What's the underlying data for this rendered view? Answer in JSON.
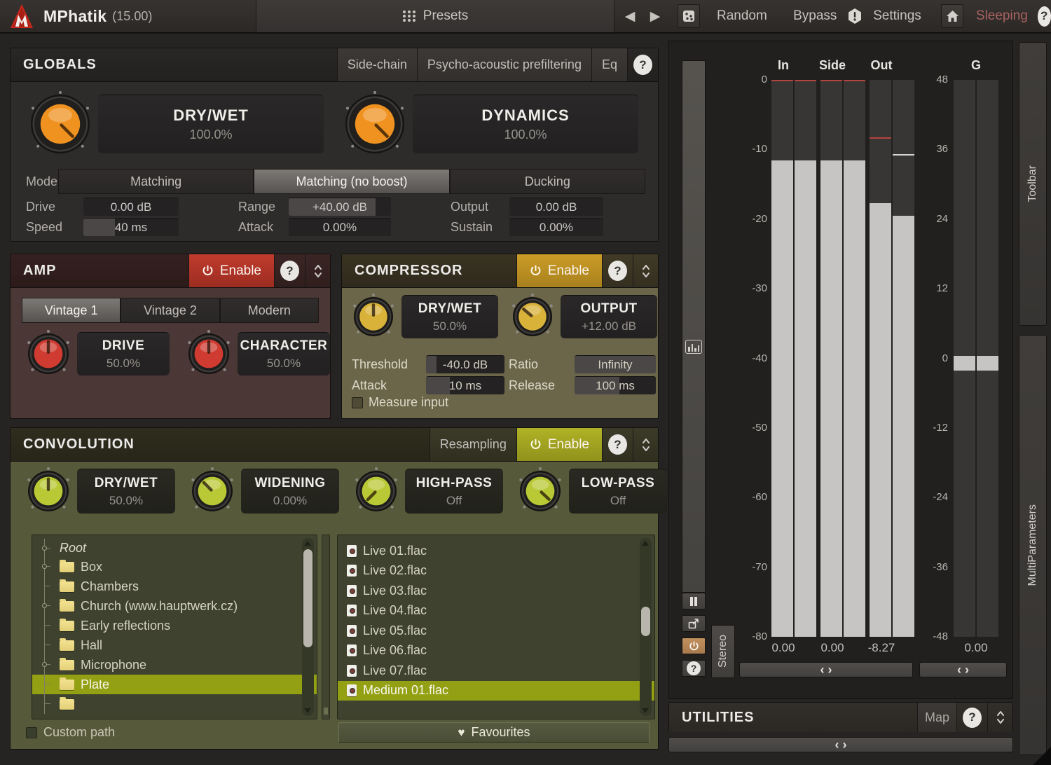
{
  "help_glyph": "?",
  "colors": {
    "knob_orange": "#ef9220",
    "knob_red": "#cf3b30",
    "knob_gold": "#d9b23a",
    "knob_green": "#b9c936",
    "enable_red": "#b03227",
    "enable_gold": "#bd9122",
    "enable_green": "#a6a81f",
    "selected_row": "#93a013",
    "meter_fill": "#c7c5c3",
    "peak_red": "#b5443c",
    "peak_white": "#d6d4d2"
  },
  "topbar": {
    "title": "MPhatik",
    "version": "(15.00)",
    "presets_label": "Presets",
    "back_icon": "left-arrow",
    "forward_icon": "right-arrow",
    "dice_icon": "dice",
    "random_label": "Random",
    "bypass_label": "Bypass",
    "warning_icon": "hexagon-exclamation",
    "settings_label": "Settings",
    "home_icon": "home",
    "sleeping_label": "Sleeping"
  },
  "globals": {
    "title": "GLOBALS",
    "tabs": [
      "Side-chain",
      "Psycho-acoustic prefiltering",
      "Eq"
    ],
    "knobs": [
      {
        "label": "DRY/WET",
        "value": "100.0%",
        "color": "#ef9220",
        "angle": 135
      },
      {
        "label": "DYNAMICS",
        "value": "100.0%",
        "color": "#ef9220",
        "angle": 135
      }
    ],
    "mode": {
      "label": "Mode",
      "options": [
        "Matching",
        "Matching (no boost)",
        "Ducking"
      ],
      "selected": 1
    },
    "params": [
      {
        "label": "Drive",
        "value": "0.00 dB",
        "fill": 0
      },
      {
        "label": "Range",
        "value": "+40.00 dB",
        "fill": 0.85
      },
      {
        "label": "Output",
        "value": "0.00 dB",
        "fill": 0
      },
      {
        "label": "Speed",
        "value": "40 ms",
        "fill": 0.33
      },
      {
        "label": "Attack",
        "value": "0.00%",
        "fill": 0
      },
      {
        "label": "Sustain",
        "value": "0.00%",
        "fill": 0
      }
    ]
  },
  "amp": {
    "title": "AMP",
    "enable_label": "Enable",
    "tabs": [
      "Vintage 1",
      "Vintage 2",
      "Modern"
    ],
    "selected_tab": 0,
    "knobs": [
      {
        "label": "DRIVE",
        "value": "50.0%",
        "color": "#cf3b30",
        "angle": 0
      },
      {
        "label": "CHARACTER",
        "value": "50.0%",
        "color": "#cf3b30",
        "angle": 0
      }
    ]
  },
  "compressor": {
    "title": "COMPRESSOR",
    "enable_label": "Enable",
    "knobs": [
      {
        "label": "DRY/WET",
        "value": "50.0%",
        "color": "#d9b23a",
        "angle": 0
      },
      {
        "label": "OUTPUT",
        "value": "+12.00 dB",
        "color": "#d9b23a",
        "angle": -50
      }
    ],
    "params": [
      {
        "label": "Threshold",
        "value": "-40.0 dB",
        "fill": 0.13
      },
      {
        "label": "Ratio",
        "value": "Infinity",
        "fill": 1
      },
      {
        "label": "Attack",
        "value": "10 ms",
        "fill": 0.3
      },
      {
        "label": "Release",
        "value": "100 ms",
        "fill": 0.55
      }
    ],
    "measure_label": "Measure input",
    "measure_checked": false
  },
  "convolution": {
    "title": "CONVOLUTION",
    "resampling_label": "Resampling",
    "enable_label": "Enable",
    "knobs": [
      {
        "label": "DRY/WET",
        "value": "50.0%",
        "color": "#b9c936",
        "angle": 0
      },
      {
        "label": "WIDENING",
        "value": "0.00%",
        "color": "#b9c936",
        "angle": -45
      },
      {
        "label": "HIGH-PASS",
        "value": "Off",
        "color": "#b9c936",
        "angle": -135
      },
      {
        "label": "LOW-PASS",
        "value": "Off",
        "color": "#b9c936",
        "angle": 133
      }
    ],
    "tree": [
      {
        "label": "Root",
        "root": true,
        "node": true
      },
      {
        "label": "Box",
        "node": true
      },
      {
        "label": "Chambers",
        "node": false
      },
      {
        "label": "Church (www.hauptwerk.cz)",
        "node": true
      },
      {
        "label": "Early reflections",
        "node": false
      },
      {
        "label": "Hall",
        "node": false
      },
      {
        "label": "Microphone",
        "node": true
      },
      {
        "label": "Plate",
        "node": false,
        "selected": true
      }
    ],
    "files": [
      {
        "label": "Live 01.flac"
      },
      {
        "label": "Live 02.flac"
      },
      {
        "label": "Live 03.flac"
      },
      {
        "label": "Live 04.flac"
      },
      {
        "label": "Live 05.flac"
      },
      {
        "label": "Live 06.flac"
      },
      {
        "label": "Live 07.flac"
      },
      {
        "label": "Medium 01.flac",
        "selected": true
      }
    ],
    "custom_path_label": "Custom path",
    "custom_path_checked": false,
    "favourites_label": "Favourites"
  },
  "meters": {
    "group_labels": [
      "In",
      "Side",
      "Out"
    ],
    "g_label": "G",
    "scale_left": [
      "0",
      "-10",
      "-20",
      "-30",
      "-40",
      "-50",
      "-60",
      "-70",
      "-80"
    ],
    "scale_right": [
      "48",
      "36",
      "24",
      "12",
      "0",
      "-12",
      "-24",
      "-36",
      "-48"
    ],
    "bars": [
      {
        "fill_from": 0.145,
        "peak_at": 0,
        "peak_color": "#b5443c"
      },
      {
        "fill_from": 0.145,
        "peak_at": 0,
        "peak_color": "#b5443c"
      },
      {
        "fill_from": 0.145,
        "peak_at": 0,
        "peak_color": "#b5443c"
      },
      {
        "fill_from": 0.145,
        "peak_at": 0,
        "peak_color": "#b5443c"
      },
      {
        "fill_from": 0.221,
        "peak_at": 0.103,
        "peak_color": "#b5443c"
      },
      {
        "fill_from": 0.244,
        "peak_at": 0.133,
        "peak_color": "#d6d4d2"
      }
    ],
    "g_blocks": [
      {
        "from": 0.495,
        "to": 0.522
      },
      {
        "from": 0.495,
        "to": 0.522
      }
    ],
    "readouts": [
      "0.00",
      "0.00",
      "-8.27",
      "0.00"
    ],
    "stereo_label": "Stereo"
  },
  "utilities": {
    "title": "UTILITIES",
    "map_label": "Map"
  },
  "side": {
    "toolbar": "Toolbar",
    "multiparameters": "MultiParameters"
  }
}
